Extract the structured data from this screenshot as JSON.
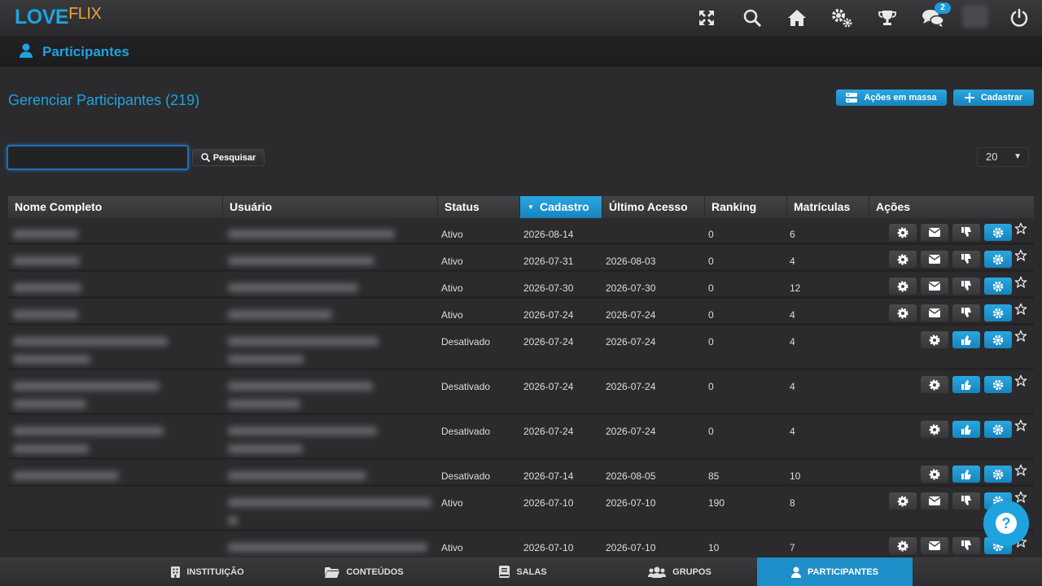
{
  "brand": {
    "part1": "LOVE",
    "part2": "FLIX"
  },
  "topbar": {
    "notifications_count": "2"
  },
  "section": {
    "title": "Participantes"
  },
  "page": {
    "title": "Gerenciar Participantes (219)",
    "bulk_actions_label": "Ações em massa",
    "register_label": "Cadastrar",
    "search_button_label": "Pesquisar",
    "search_value": "",
    "per_page": "20"
  },
  "table": {
    "headers": [
      "Nome Completo",
      "Usuário",
      "Status",
      "Cadastro",
      "Último Acesso",
      "Ranking",
      "Matrículas",
      "Ações"
    ],
    "sorted_column": "Cadastro",
    "rows": [
      {
        "status": "Ativo",
        "cadastro": "2026-08-14",
        "ultimo_acesso": "",
        "ranking": "0",
        "matriculas": "6"
      },
      {
        "status": "Ativo",
        "cadastro": "2026-07-31",
        "ultimo_acesso": "2026-08-03",
        "ranking": "0",
        "matriculas": "4"
      },
      {
        "status": "Ativo",
        "cadastro": "2026-07-30",
        "ultimo_acesso": "2026-07-30",
        "ranking": "0",
        "matriculas": "12"
      },
      {
        "status": "Ativo",
        "cadastro": "2026-07-24",
        "ultimo_acesso": "2026-07-24",
        "ranking": "0",
        "matriculas": "4"
      },
      {
        "status": "Desativado",
        "cadastro": "2026-07-24",
        "ultimo_acesso": "2026-07-24",
        "ranking": "0",
        "matriculas": "4"
      },
      {
        "status": "Desativado",
        "cadastro": "2026-07-24",
        "ultimo_acesso": "2026-07-24",
        "ranking": "0",
        "matriculas": "4"
      },
      {
        "status": "Desativado",
        "cadastro": "2026-07-24",
        "ultimo_acesso": "2026-07-24",
        "ranking": "0",
        "matriculas": "4"
      },
      {
        "status": "Desativado",
        "cadastro": "2026-07-14",
        "ultimo_acesso": "2026-08-05",
        "ranking": "85",
        "matriculas": "10"
      },
      {
        "status": "Ativo",
        "cadastro": "2026-07-10",
        "ultimo_acesso": "2026-07-10",
        "ranking": "190",
        "matriculas": "8"
      },
      {
        "status": "Ativo",
        "cadastro": "2026-07-10",
        "ultimo_acesso": "2026-07-10",
        "ranking": "10",
        "matriculas": "7"
      }
    ]
  },
  "bottom_nav": {
    "items": [
      "INSTITUIÇÃO",
      "CONTEÚDOS",
      "SALAS",
      "GRUPOS",
      "PARTICIPANTES"
    ],
    "active": "PARTICIPANTES"
  },
  "colors": {
    "accent": "#1ea3df",
    "logo_secondary": "#f0a23a",
    "background": "#2b2b2d"
  }
}
